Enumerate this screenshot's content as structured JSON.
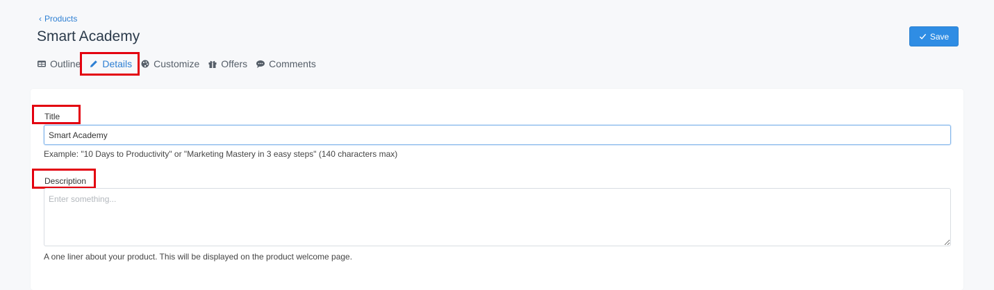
{
  "breadcrumb": {
    "label": "Products"
  },
  "page": {
    "title": "Smart Academy"
  },
  "toolbar": {
    "save_label": "Save"
  },
  "tabs": [
    {
      "label": "Outline",
      "icon": "table-icon"
    },
    {
      "label": "Details",
      "icon": "pencil-icon",
      "active": true
    },
    {
      "label": "Customize",
      "icon": "palette-icon"
    },
    {
      "label": "Offers",
      "icon": "gift-icon"
    },
    {
      "label": "Comments",
      "icon": "comment-icon"
    }
  ],
  "form": {
    "title": {
      "label": "Title",
      "value": "Smart Academy",
      "help": "Example: \"10 Days to Productivity\" or \"Marketing Mastery in 3 easy steps\" (140 characters max)"
    },
    "description": {
      "label": "Description",
      "placeholder": "Enter something...",
      "value": "",
      "help": "A one liner about your product. This will be displayed on the product welcome page."
    }
  },
  "colors": {
    "accent": "#2f8de4",
    "link": "#2d7fd3",
    "highlight": "#e3000f",
    "background": "#f7f8fa"
  }
}
